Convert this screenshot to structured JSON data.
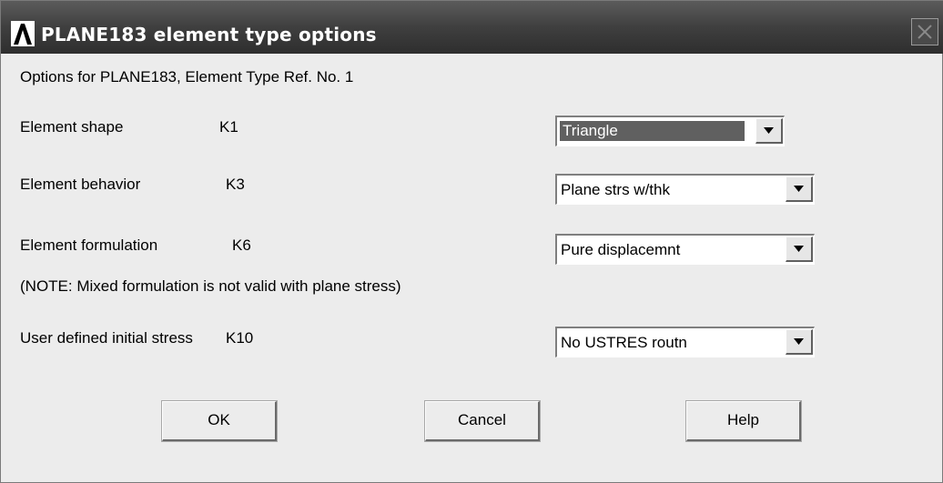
{
  "window": {
    "title": "PLANE183 element type options",
    "logo_icon": "ansys-logo-icon",
    "close_icon": "close-icon"
  },
  "header_text": "Options for PLANE183, Element Type Ref. No. 1",
  "options": [
    {
      "label": "Element shape",
      "key": "K1",
      "value": "Triangle"
    },
    {
      "label": "Element behavior",
      "key": "K3",
      "value": "Plane strs w/thk"
    },
    {
      "label": "Element formulation",
      "key": "K6",
      "value": "Pure displacemnt"
    },
    {
      "label": "User defined initial stress",
      "key": "K10",
      "value": "No USTRES routn"
    }
  ],
  "note": "(NOTE: Mixed formulation is not valid with plane stress)",
  "buttons": {
    "ok": "OK",
    "cancel": "Cancel",
    "help": "Help"
  },
  "colors": {
    "titlebar": "#3f3f3f",
    "dialog_bg": "#ececec",
    "selected_highlight": "#606060"
  }
}
